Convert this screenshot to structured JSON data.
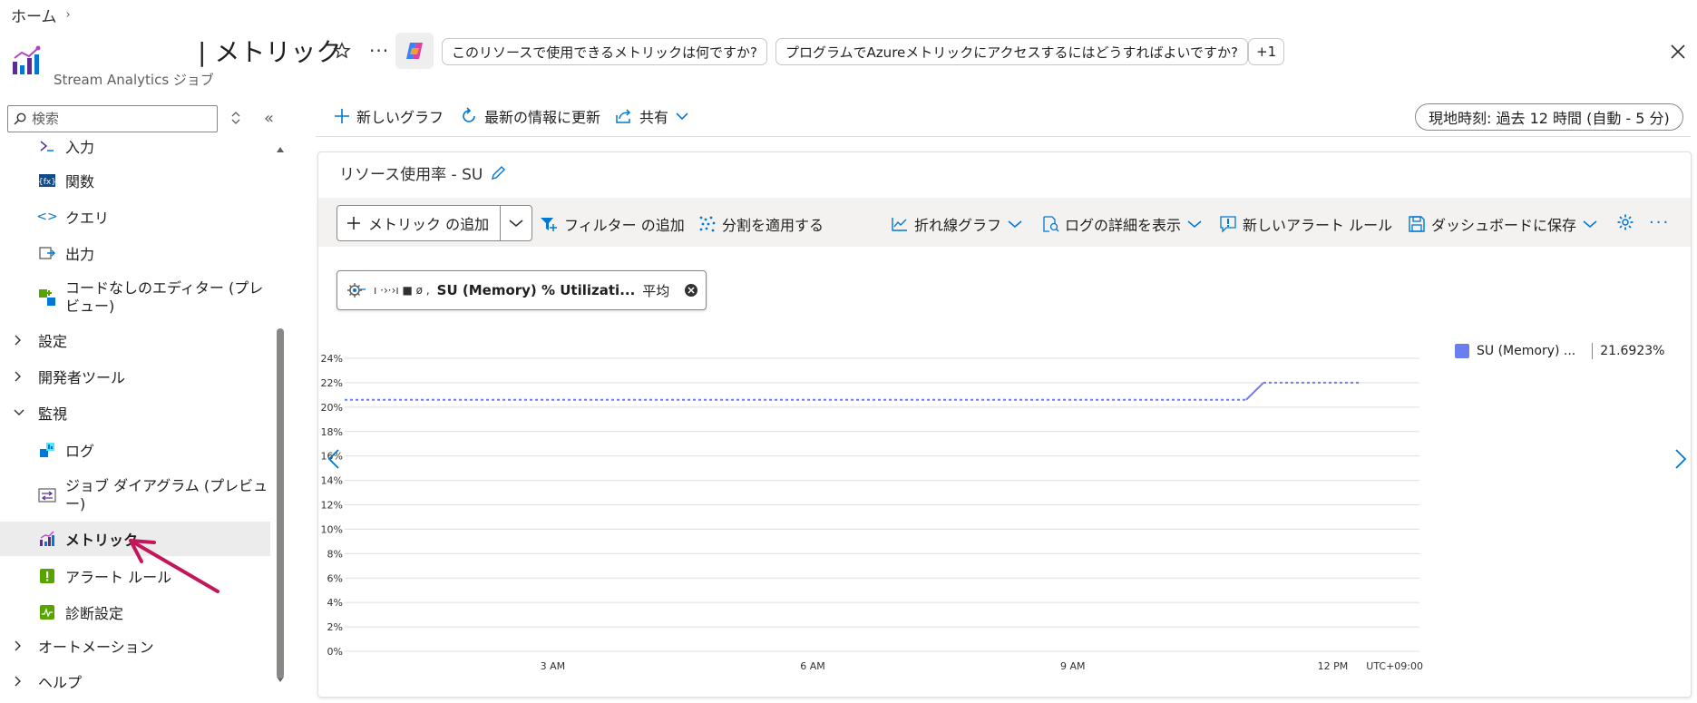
{
  "breadcrumb": {
    "home": "ホーム"
  },
  "header": {
    "title": "| メトリック",
    "subtitle": "Stream Analytics ジョブ",
    "more": "···",
    "suggestions": [
      "このリソースで使用できるメトリックは何ですか?",
      "プログラムでAzureメトリックにアクセスするにはどうすればよいですか?",
      "+1"
    ]
  },
  "sidebar": {
    "search_placeholder": "検索",
    "items": [
      {
        "label": "入力",
        "icon": "input-icon"
      },
      {
        "label": "関数",
        "icon": "function-icon"
      },
      {
        "label": "クエリ",
        "icon": "query-icon"
      },
      {
        "label": "出力",
        "icon": "output-icon"
      },
      {
        "label": "コードなしのエディター (プレ",
        "label2": "ビュー)",
        "icon": "no-code-editor-icon"
      },
      {
        "label": "設定",
        "group": true
      },
      {
        "label": "開発者ツール",
        "group": true
      },
      {
        "label": "監視",
        "group": true,
        "expanded": true
      },
      {
        "label": "ログ",
        "icon": "logs-icon"
      },
      {
        "label": "ジョブ ダイアグラム (プレビュ",
        "label2": "ー)",
        "icon": "job-diagram-icon"
      },
      {
        "label": "メトリック",
        "icon": "metrics-icon",
        "active": true
      },
      {
        "label": "アラート ルール",
        "icon": "alert-rules-icon"
      },
      {
        "label": "診断設定",
        "icon": "diagnostic-settings-icon"
      },
      {
        "label": "オートメーション",
        "group": true
      },
      {
        "label": "ヘルプ",
        "group": true
      }
    ]
  },
  "commandbar": {
    "new_chart": "新しいグラフ",
    "refresh": "最新の情報に更新",
    "share": "共有",
    "time_range": "現地時刻: 過去 12 時間 (自動 - 5 分)"
  },
  "chart_card": {
    "title": "リソース使用率 - SU",
    "toolbar": {
      "add_metric": "メトリック の追加",
      "add_filter": "フィルター の追加",
      "apply_split": "分割を適用する",
      "line_chart": "折れ線グラフ",
      "view_logs": "ログの詳細を表示",
      "new_alert": "新しいアラート ルール",
      "save_dashboard": "ダッシュボードに保存"
    },
    "metric_pill": {
      "resource": "ı ·›·›ı ■ ø ,",
      "name": "SU (Memory) % Utilizati...",
      "aggregation": "平均"
    },
    "legend": {
      "name": "SU (Memory) ...",
      "value": "21.6923%"
    }
  },
  "chart_data": {
    "type": "line",
    "ylim": [
      0,
      24
    ],
    "y_ticks": [
      "0%",
      "2%",
      "4%",
      "6%",
      "8%",
      "10%",
      "12%",
      "14%",
      "16%",
      "18%",
      "20%",
      "22%",
      "24%"
    ],
    "x_ticks": [
      "3 AM",
      "6 AM",
      "9 AM",
      "12 PM"
    ],
    "x_tick_hours": [
      3,
      6,
      9,
      12
    ],
    "timezone": "UTC+09:00",
    "xlim_hours": [
      0.6,
      13.0
    ],
    "series": [
      {
        "name": "SU (Memory) ...",
        "color": "#6b7ef0",
        "dashed_segments": [
          [
            [
              0.6,
              20.6
            ],
            [
              11.0,
              20.6
            ]
          ],
          [
            [
              11.2,
              22.0
            ],
            [
              12.3,
              22.0
            ]
          ]
        ],
        "solid_segments": [
          [
            [
              11.0,
              20.6
            ],
            [
              11.2,
              22.0
            ]
          ]
        ]
      }
    ]
  }
}
